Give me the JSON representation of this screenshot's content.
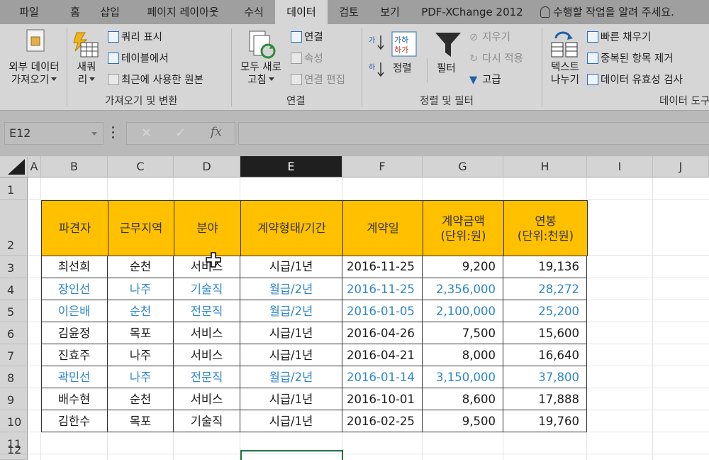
{
  "menu": {
    "tabs": [
      "파일",
      "홈",
      "삽입",
      "페이지 레이아웃",
      "수식",
      "데이터",
      "검토",
      "보기",
      "PDF-XChange 2012"
    ],
    "active": "데이터",
    "tell_me": "수행할 작업을 알려 주세요."
  },
  "ribbon": {
    "get_external_data": [
      "외부 데이터",
      "가져오기"
    ],
    "new_query": [
      "새쿼",
      "리"
    ],
    "show_queries": "쿼리 표시",
    "from_table": "테이블에서",
    "recent_sources": "최근에 사용한 원본",
    "group_get_transform": "가져오기 및 변환",
    "refresh_all": [
      "모두 새로",
      "고침"
    ],
    "connections": "연결",
    "properties": "속성",
    "edit_links": "연결 편집",
    "group_connections": "연결",
    "sort": "정렬",
    "filter": "필터",
    "clear": "지우기",
    "reapply": "다시 적용",
    "advanced": "고급",
    "group_sort_filter": "정렬 및 필터",
    "text_to_columns": [
      "텍스트",
      "나누기"
    ],
    "flash_fill": "빠른 채우기",
    "remove_duplicates": "중복된 항목 제거",
    "data_validation": "데이터 유효성 검사",
    "group_data_tools": "데이터 도구"
  },
  "formula_bar": {
    "name_box": "E12",
    "fx": "fx",
    "value": ""
  },
  "grid": {
    "columns": [
      "A",
      "B",
      "C",
      "D",
      "E",
      "F",
      "G",
      "H",
      "I",
      "J"
    ],
    "selected_column": "E",
    "rows": [
      "1",
      "2",
      "3",
      "4",
      "5",
      "6",
      "7",
      "8",
      "9",
      "10",
      "11",
      "12"
    ],
    "table_headers": [
      "파견자",
      "근무지역",
      "분야",
      "계약형태/기간",
      "계약일",
      "계약금액\n(단위:원)",
      "연봉\n(단위:천원)"
    ],
    "table_rows": [
      {
        "cells": [
          "최선희",
          "순천",
          "서비스",
          "시급/1년",
          "2016-11-25",
          "9,200",
          "19,136"
        ],
        "color": "#1a1a1a"
      },
      {
        "cells": [
          "장인선",
          "나주",
          "기술직",
          "월급/2년",
          "2016-11-25",
          "2,356,000",
          "28,272"
        ],
        "color": "#2e86c8"
      },
      {
        "cells": [
          "이은배",
          "순천",
          "전문직",
          "월급/2년",
          "2016-01-05",
          "2,100,000",
          "25,200"
        ],
        "color": "#2e86c8"
      },
      {
        "cells": [
          "김윤정",
          "목포",
          "서비스",
          "시급/1년",
          "2016-04-26",
          "7,500",
          "15,600"
        ],
        "color": "#1a1a1a"
      },
      {
        "cells": [
          "진효주",
          "나주",
          "서비스",
          "시급/1년",
          "2016-04-21",
          "8,000",
          "16,640"
        ],
        "color": "#1a1a1a"
      },
      {
        "cells": [
          "곽민선",
          "나주",
          "전문직",
          "월급/2년",
          "2016-01-14",
          "3,150,000",
          "37,800"
        ],
        "color": "#2e86c8"
      },
      {
        "cells": [
          "배수현",
          "순천",
          "서비스",
          "시급/1년",
          "2016-10-01",
          "8,600",
          "17,888"
        ],
        "color": "#1a1a1a"
      },
      {
        "cells": [
          "김한수",
          "목포",
          "기술직",
          "시급/1년",
          "2016-02-25",
          "9,500",
          "19,760"
        ],
        "color": "#1a1a1a"
      }
    ]
  },
  "colors": {
    "header_fill": "#ffc000",
    "highlight_text": "#2e86c8",
    "selection": "#217346"
  }
}
